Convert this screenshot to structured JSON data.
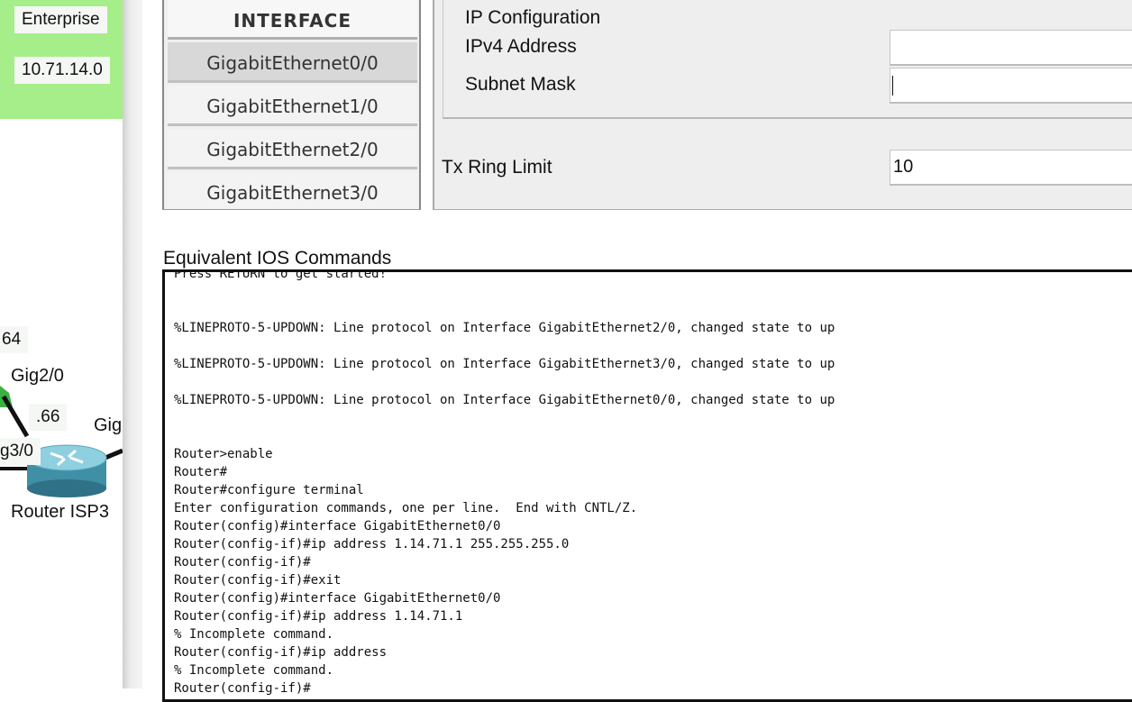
{
  "topology": {
    "labels": {
      "enterprise": "Enterprise",
      "network": "10.71.14.0",
      "addr_64": "64",
      "gig20": "Gig2/0",
      "addr_66": ".66",
      "gig_partial": "Gig",
      "g30_partial": "g3/0",
      "router_name": "Router ISP3"
    },
    "colors": {
      "enterprise_area": "#a6ee8a",
      "link_green": "#3cb043"
    }
  },
  "interface_panel": {
    "header": "INTERFACE",
    "items": [
      {
        "label": "GigabitEthernet0/0",
        "selected": true
      },
      {
        "label": "GigabitEthernet1/0",
        "selected": false
      },
      {
        "label": "GigabitEthernet2/0",
        "selected": false
      },
      {
        "label": "GigabitEthernet3/0",
        "selected": false
      }
    ]
  },
  "config": {
    "ip_config_title": "IP Configuration",
    "ipv4_label": "IPv4 Address",
    "ipv4_value": "",
    "subnet_label": "Subnet Mask",
    "subnet_value": "",
    "tx_ring_label": "Tx Ring Limit",
    "tx_ring_value": "10"
  },
  "ios": {
    "title": "Equivalent IOS Commands",
    "lines": [
      "Press RETURN to get started!",
      "",
      "",
      "%LINEPROTO-5-UPDOWN: Line protocol on Interface GigabitEthernet2/0, changed state to up",
      "",
      "%LINEPROTO-5-UPDOWN: Line protocol on Interface GigabitEthernet3/0, changed state to up",
      "",
      "%LINEPROTO-5-UPDOWN: Line protocol on Interface GigabitEthernet0/0, changed state to up",
      "",
      "",
      "Router>enable",
      "Router#",
      "Router#configure terminal",
      "Enter configuration commands, one per line.  End with CNTL/Z.",
      "Router(config)#interface GigabitEthernet0/0",
      "Router(config-if)#ip address 1.14.71.1 255.255.255.0",
      "Router(config-if)#",
      "Router(config-if)#exit",
      "Router(config)#interface GigabitEthernet0/0",
      "Router(config-if)#ip address 1.14.71.1",
      "% Incomplete command.",
      "Router(config-if)#ip address",
      "% Incomplete command.",
      "Router(config-if)#"
    ]
  }
}
